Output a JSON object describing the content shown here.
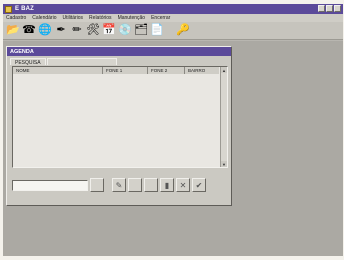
{
  "window": {
    "title": "E BAZ"
  },
  "menu": [
    "Cadastro",
    "Calendário",
    "Utilitários",
    "Relatórios",
    "Manutenção",
    "Encerrar"
  ],
  "toolbar_icons": [
    "folder-icon",
    "phone-icon",
    "globe-icon",
    "pen-icon",
    "pencil-icon",
    "tools-icon",
    "calendar-icon",
    "disk-icon",
    "card-icon",
    "page-icon",
    "key-icon"
  ],
  "agenda": {
    "title": "AGENDA",
    "tabs": [
      "PESQUISA",
      ""
    ],
    "columns": [
      "NOME",
      "FONE 1",
      "FONE 2",
      "BAIRRO"
    ],
    "search_value": ""
  },
  "controls": [
    "edit-icon",
    "first-icon",
    "prev-icon",
    "next-icon",
    "delete-icon",
    "ok-icon"
  ]
}
